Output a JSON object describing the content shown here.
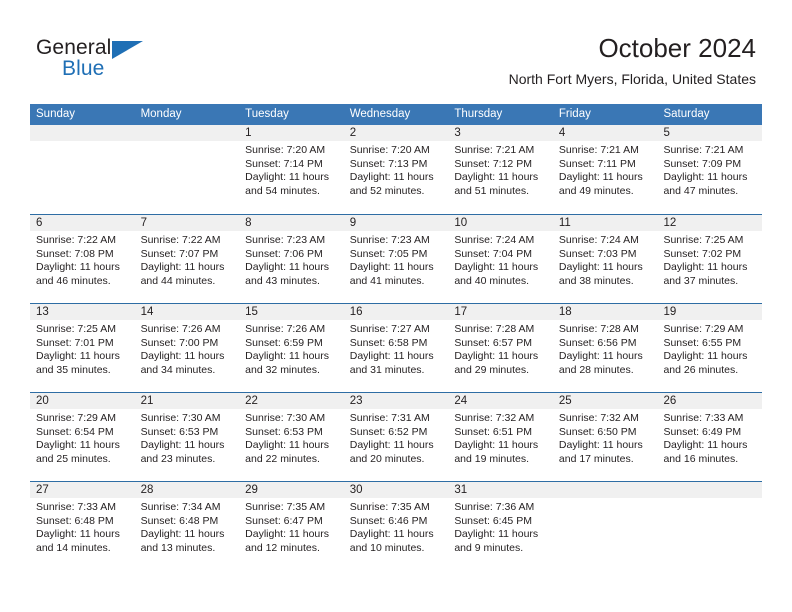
{
  "brand": {
    "word_general": "General",
    "word_blue": "Blue",
    "flag_icon": "triangle-flag-icon"
  },
  "header": {
    "title": "October 2024",
    "subtitle": "North Fort Myers, Florida, United States"
  },
  "colors": {
    "header_blue": "#3a77b5",
    "separator_blue": "#2e6da4",
    "datebar_gray": "#f0f0f0",
    "brand_blue": "#1f6fb5",
    "text": "#231f20"
  },
  "weekdays": [
    "Sunday",
    "Monday",
    "Tuesday",
    "Wednesday",
    "Thursday",
    "Friday",
    "Saturday"
  ],
  "weeks": [
    [
      {
        "day": "",
        "sunrise": "",
        "sunset": "",
        "daylight": "",
        "daylight2": ""
      },
      {
        "day": "",
        "sunrise": "",
        "sunset": "",
        "daylight": "",
        "daylight2": ""
      },
      {
        "day": "1",
        "sunrise": "Sunrise: 7:20 AM",
        "sunset": "Sunset: 7:14 PM",
        "daylight": "Daylight: 11 hours",
        "daylight2": "and 54 minutes."
      },
      {
        "day": "2",
        "sunrise": "Sunrise: 7:20 AM",
        "sunset": "Sunset: 7:13 PM",
        "daylight": "Daylight: 11 hours",
        "daylight2": "and 52 minutes."
      },
      {
        "day": "3",
        "sunrise": "Sunrise: 7:21 AM",
        "sunset": "Sunset: 7:12 PM",
        "daylight": "Daylight: 11 hours",
        "daylight2": "and 51 minutes."
      },
      {
        "day": "4",
        "sunrise": "Sunrise: 7:21 AM",
        "sunset": "Sunset: 7:11 PM",
        "daylight": "Daylight: 11 hours",
        "daylight2": "and 49 minutes."
      },
      {
        "day": "5",
        "sunrise": "Sunrise: 7:21 AM",
        "sunset": "Sunset: 7:09 PM",
        "daylight": "Daylight: 11 hours",
        "daylight2": "and 47 minutes."
      }
    ],
    [
      {
        "day": "6",
        "sunrise": "Sunrise: 7:22 AM",
        "sunset": "Sunset: 7:08 PM",
        "daylight": "Daylight: 11 hours",
        "daylight2": "and 46 minutes."
      },
      {
        "day": "7",
        "sunrise": "Sunrise: 7:22 AM",
        "sunset": "Sunset: 7:07 PM",
        "daylight": "Daylight: 11 hours",
        "daylight2": "and 44 minutes."
      },
      {
        "day": "8",
        "sunrise": "Sunrise: 7:23 AM",
        "sunset": "Sunset: 7:06 PM",
        "daylight": "Daylight: 11 hours",
        "daylight2": "and 43 minutes."
      },
      {
        "day": "9",
        "sunrise": "Sunrise: 7:23 AM",
        "sunset": "Sunset: 7:05 PM",
        "daylight": "Daylight: 11 hours",
        "daylight2": "and 41 minutes."
      },
      {
        "day": "10",
        "sunrise": "Sunrise: 7:24 AM",
        "sunset": "Sunset: 7:04 PM",
        "daylight": "Daylight: 11 hours",
        "daylight2": "and 40 minutes."
      },
      {
        "day": "11",
        "sunrise": "Sunrise: 7:24 AM",
        "sunset": "Sunset: 7:03 PM",
        "daylight": "Daylight: 11 hours",
        "daylight2": "and 38 minutes."
      },
      {
        "day": "12",
        "sunrise": "Sunrise: 7:25 AM",
        "sunset": "Sunset: 7:02 PM",
        "daylight": "Daylight: 11 hours",
        "daylight2": "and 37 minutes."
      }
    ],
    [
      {
        "day": "13",
        "sunrise": "Sunrise: 7:25 AM",
        "sunset": "Sunset: 7:01 PM",
        "daylight": "Daylight: 11 hours",
        "daylight2": "and 35 minutes."
      },
      {
        "day": "14",
        "sunrise": "Sunrise: 7:26 AM",
        "sunset": "Sunset: 7:00 PM",
        "daylight": "Daylight: 11 hours",
        "daylight2": "and 34 minutes."
      },
      {
        "day": "15",
        "sunrise": "Sunrise: 7:26 AM",
        "sunset": "Sunset: 6:59 PM",
        "daylight": "Daylight: 11 hours",
        "daylight2": "and 32 minutes."
      },
      {
        "day": "16",
        "sunrise": "Sunrise: 7:27 AM",
        "sunset": "Sunset: 6:58 PM",
        "daylight": "Daylight: 11 hours",
        "daylight2": "and 31 minutes."
      },
      {
        "day": "17",
        "sunrise": "Sunrise: 7:28 AM",
        "sunset": "Sunset: 6:57 PM",
        "daylight": "Daylight: 11 hours",
        "daylight2": "and 29 minutes."
      },
      {
        "day": "18",
        "sunrise": "Sunrise: 7:28 AM",
        "sunset": "Sunset: 6:56 PM",
        "daylight": "Daylight: 11 hours",
        "daylight2": "and 28 minutes."
      },
      {
        "day": "19",
        "sunrise": "Sunrise: 7:29 AM",
        "sunset": "Sunset: 6:55 PM",
        "daylight": "Daylight: 11 hours",
        "daylight2": "and 26 minutes."
      }
    ],
    [
      {
        "day": "20",
        "sunrise": "Sunrise: 7:29 AM",
        "sunset": "Sunset: 6:54 PM",
        "daylight": "Daylight: 11 hours",
        "daylight2": "and 25 minutes."
      },
      {
        "day": "21",
        "sunrise": "Sunrise: 7:30 AM",
        "sunset": "Sunset: 6:53 PM",
        "daylight": "Daylight: 11 hours",
        "daylight2": "and 23 minutes."
      },
      {
        "day": "22",
        "sunrise": "Sunrise: 7:30 AM",
        "sunset": "Sunset: 6:53 PM",
        "daylight": "Daylight: 11 hours",
        "daylight2": "and 22 minutes."
      },
      {
        "day": "23",
        "sunrise": "Sunrise: 7:31 AM",
        "sunset": "Sunset: 6:52 PM",
        "daylight": "Daylight: 11 hours",
        "daylight2": "and 20 minutes."
      },
      {
        "day": "24",
        "sunrise": "Sunrise: 7:32 AM",
        "sunset": "Sunset: 6:51 PM",
        "daylight": "Daylight: 11 hours",
        "daylight2": "and 19 minutes."
      },
      {
        "day": "25",
        "sunrise": "Sunrise: 7:32 AM",
        "sunset": "Sunset: 6:50 PM",
        "daylight": "Daylight: 11 hours",
        "daylight2": "and 17 minutes."
      },
      {
        "day": "26",
        "sunrise": "Sunrise: 7:33 AM",
        "sunset": "Sunset: 6:49 PM",
        "daylight": "Daylight: 11 hours",
        "daylight2": "and 16 minutes."
      }
    ],
    [
      {
        "day": "27",
        "sunrise": "Sunrise: 7:33 AM",
        "sunset": "Sunset: 6:48 PM",
        "daylight": "Daylight: 11 hours",
        "daylight2": "and 14 minutes."
      },
      {
        "day": "28",
        "sunrise": "Sunrise: 7:34 AM",
        "sunset": "Sunset: 6:48 PM",
        "daylight": "Daylight: 11 hours",
        "daylight2": "and 13 minutes."
      },
      {
        "day": "29",
        "sunrise": "Sunrise: 7:35 AM",
        "sunset": "Sunset: 6:47 PM",
        "daylight": "Daylight: 11 hours",
        "daylight2": "and 12 minutes."
      },
      {
        "day": "30",
        "sunrise": "Sunrise: 7:35 AM",
        "sunset": "Sunset: 6:46 PM",
        "daylight": "Daylight: 11 hours",
        "daylight2": "and 10 minutes."
      },
      {
        "day": "31",
        "sunrise": "Sunrise: 7:36 AM",
        "sunset": "Sunset: 6:45 PM",
        "daylight": "Daylight: 11 hours",
        "daylight2": "and 9 minutes."
      },
      {
        "day": "",
        "sunrise": "",
        "sunset": "",
        "daylight": "",
        "daylight2": ""
      },
      {
        "day": "",
        "sunrise": "",
        "sunset": "",
        "daylight": "",
        "daylight2": ""
      }
    ]
  ]
}
